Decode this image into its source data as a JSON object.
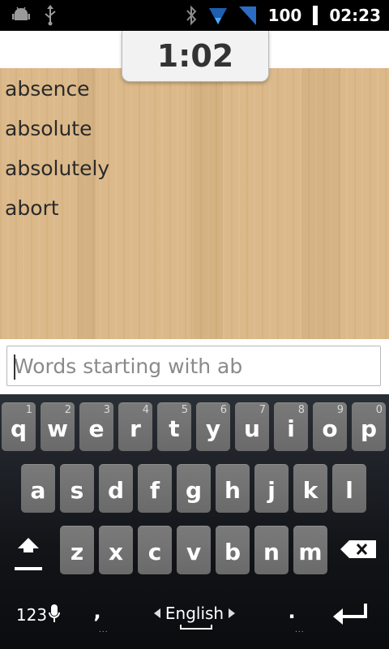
{
  "status_bar": {
    "icons_left": [
      "android-debug-icon",
      "usb-icon"
    ],
    "icons_right": [
      "bluetooth-icon",
      "wifi-icon",
      "signal-icon"
    ],
    "battery": "100",
    "time": "02:23"
  },
  "timer": "1:02",
  "words": [
    "absence",
    "absolute",
    "absolutely",
    "abort"
  ],
  "input": {
    "value": "",
    "placeholder": "Words starting with ab"
  },
  "keyboard": {
    "row1": [
      {
        "ch": "q",
        "num": "1"
      },
      {
        "ch": "w",
        "num": "2"
      },
      {
        "ch": "e",
        "num": "3"
      },
      {
        "ch": "r",
        "num": "4"
      },
      {
        "ch": "t",
        "num": "5"
      },
      {
        "ch": "y",
        "num": "6"
      },
      {
        "ch": "u",
        "num": "7"
      },
      {
        "ch": "i",
        "num": "8"
      },
      {
        "ch": "o",
        "num": "9"
      },
      {
        "ch": "p",
        "num": "0"
      }
    ],
    "row2": [
      "a",
      "s",
      "d",
      "f",
      "g",
      "h",
      "j",
      "k",
      "l"
    ],
    "row3": [
      "z",
      "x",
      "c",
      "v",
      "b",
      "n",
      "m"
    ],
    "symbols_label": "123",
    "comma": ",",
    "language": "English",
    "period": ".",
    "colors": {
      "key": "#6f6f6f",
      "background": "#121418"
    }
  }
}
